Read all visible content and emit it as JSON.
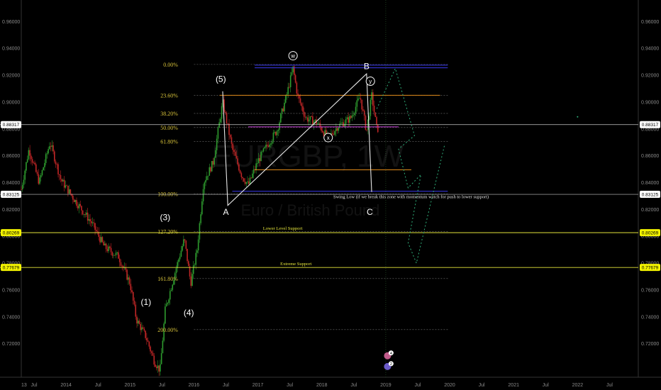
{
  "chart_data": {
    "type": "candlestick",
    "symbol_watermark": "EURGBP, 1W",
    "name_watermark": "Euro / British Pound",
    "x_axis_labels": [
      "13",
      "Jul",
      "2014",
      "Jul",
      "2015",
      "Jul",
      "2016",
      "Jul",
      "2017",
      "Jul",
      "2018",
      "Jul",
      "2019",
      "Jul",
      "2020",
      "Jul",
      "2021",
      "Jul",
      "2022",
      "Jul"
    ],
    "y_axis_labels": [
      "0.96000",
      "0.94000",
      "0.92000",
      "0.90000",
      "0.88000",
      "0.86000",
      "0.84000",
      "0.82000",
      "0.80000",
      "0.78000",
      "0.76000",
      "0.74000",
      "0.72000"
    ],
    "ylim": [
      0.695,
      0.976
    ],
    "xlim": [
      2013.3,
      2022.95
    ],
    "price_markers": [
      {
        "label": "0.88317",
        "value": 0.88317,
        "style": "white"
      },
      {
        "label": "0.83125",
        "value": 0.83125,
        "style": "white"
      },
      {
        "label": "0.80269",
        "value": 0.80269,
        "style": "yellow"
      },
      {
        "label": "0.77679",
        "value": 0.77679,
        "style": "yellow"
      }
    ],
    "fib_levels": [
      {
        "label": "0.00%",
        "value": 0.928
      },
      {
        "label": "23.60%",
        "value": 0.905
      },
      {
        "label": "38.20%",
        "value": 0.8915
      },
      {
        "label": "50.00%",
        "value": 0.881
      },
      {
        "label": "61.80%",
        "value": 0.8705
      },
      {
        "label": "100.00%",
        "value": 0.8315
      },
      {
        "label": "127.20%",
        "value": 0.8035
      },
      {
        "label": "161.80%",
        "value": 0.7685
      },
      {
        "label": "200.00%",
        "value": 0.7305
      }
    ],
    "wave_labels": [
      {
        "text": "(1)",
        "x": 2015.25,
        "y": 0.749
      },
      {
        "text": "(3)",
        "x": 2015.55,
        "y": 0.812
      },
      {
        "text": "(4)",
        "x": 2015.92,
        "y": 0.741
      },
      {
        "text": "(5)",
        "x": 2016.42,
        "y": 0.915
      },
      {
        "text": "A",
        "x": 2016.5,
        "y": 0.816
      },
      {
        "text": "B",
        "x": 2018.7,
        "y": 0.9245
      },
      {
        "text": "C",
        "x": 2018.75,
        "y": 0.816
      }
    ],
    "circled_labels": [
      {
        "text": "w",
        "x": 2017.55,
        "y": 0.9345
      },
      {
        "text": "x",
        "x": 2018.1,
        "y": 0.8735
      },
      {
        "text": "y",
        "x": 2018.76,
        "y": 0.9155
      }
    ],
    "annotations": [
      {
        "text": "Swing Low (if we break this zone with momentum watch for push to lower support)",
        "x": 2018.18,
        "y": 0.8283,
        "color": "#e6e6e6"
      },
      {
        "text": "Lower Level Support",
        "x": 2017.08,
        "y": 0.8048,
        "color": "#e4e43a"
      },
      {
        "text": "Extreme Support",
        "x": 2017.35,
        "y": 0.7785,
        "color": "#e4e43a"
      }
    ],
    "event_badges": [
      "4",
      "2"
    ],
    "grid": false,
    "legend": "none"
  }
}
